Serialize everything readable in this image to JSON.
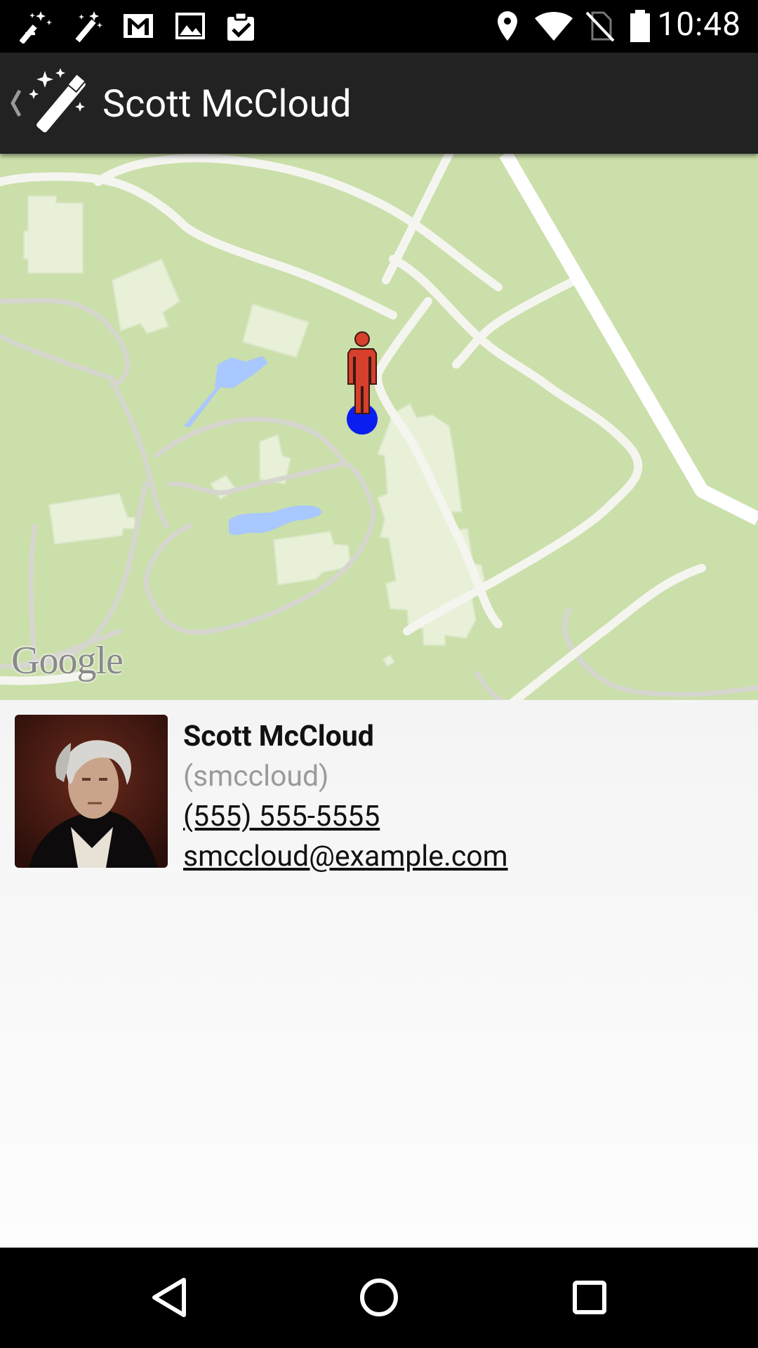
{
  "status_bar": {
    "time": "10:48",
    "notification_icons": [
      "magic-wand-sparkle-icon",
      "magic-wand-icon",
      "gmail-icon",
      "image-icon",
      "clipboard-check-icon"
    ],
    "system_icons": [
      "location-icon",
      "wifi-icon",
      "no-sim-icon",
      "battery-icon"
    ]
  },
  "action_bar": {
    "title": "Scott McCloud",
    "app_icon": "magic-wand-icon"
  },
  "map": {
    "attribution": "Google"
  },
  "contact": {
    "name": "Scott McCloud",
    "username": "(smccloud)",
    "phone": "(555) 555-5555",
    "email": "smccloud@example.com"
  },
  "nav_bar": {
    "buttons": [
      "back-icon",
      "home-icon",
      "recents-icon"
    ]
  }
}
